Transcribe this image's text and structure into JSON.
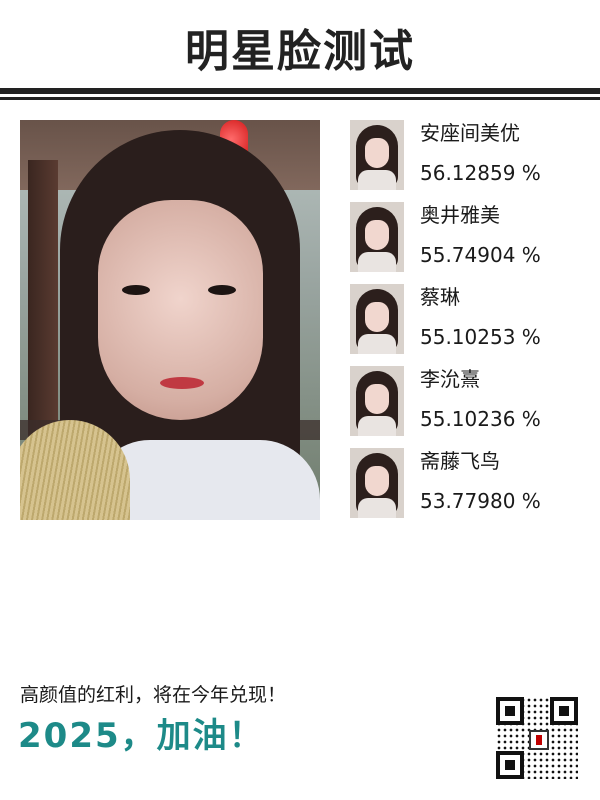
{
  "header": {
    "title": "明星脸测试"
  },
  "matches": [
    {
      "name": "安座间美优",
      "score": "56.12859 %"
    },
    {
      "name": "奥井雅美",
      "score": "55.74904 %"
    },
    {
      "name": "蔡琳",
      "score": "55.10253 %"
    },
    {
      "name": "李沇熹",
      "score": "55.10236 %"
    },
    {
      "name": "斋藤飞鸟",
      "score": "53.77980 %"
    }
  ],
  "footer": {
    "line1": "高颜值的红利，将在今年兑现！",
    "line2": "2025，加油！"
  },
  "colors": {
    "accent_teal": "#1d8a88",
    "header_rule": "#222222"
  }
}
